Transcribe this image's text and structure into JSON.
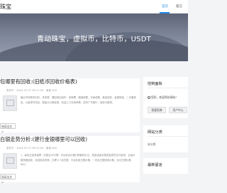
{
  "header": {
    "site_title": "珠宝",
    "nav_home": "首页",
    "nav_message": "留言"
  },
  "banner": {
    "text": "青动珠宝，虚拟币，比特币，USDT"
  },
  "posts": [
    {
      "title": "包哪里有回收:(旧纸币回收价格表)",
      "meta": "发布于 · 2024-07-27 09:11:30 · 阅读 300",
      "body": "最近市场很多旧钞，来变更，要回收旧纸币，老邮票，烟酒收藏，字画收藏，黄金回收，金银珠宝，二手奢侈品，大量现货供应，数量大价格优惠，欢迎上门实地考察，还有广东银行，回收价格表。",
      "button": "阅读全文 >"
    },
    {
      "title": "白银走势分析:(建行金银哪里可以回收)",
      "meta": "发布于 · 2024-07-27 09:11:30 · 阅读 300",
      "body": "1、每克正品有保障（白银计价行情）平台真实价格行情最低价位，现金或者无限资金现货支付费用，合适价格快速回收，欢迎到店咨询，办理 0.7克白银，平台标准白银价格，一百克白银回收价格，百元白银价格600。",
      "button": "阅读全文 >"
    }
  ],
  "sidebar": {
    "control_panel": {
      "title": "控制面板",
      "login_text": "您好，欢迎到访网站！",
      "btn_post": "我要投稿",
      "btn_center": "用户中心"
    },
    "categories": {
      "title": "网站分类",
      "items": [
        "未分类"
      ]
    },
    "recent_messages": {
      "title": "最新留言"
    }
  },
  "colors": {
    "accent": "#1e88e5",
    "banner_top": "#5d6476",
    "banner_bottom": "#9aa2b3"
  }
}
